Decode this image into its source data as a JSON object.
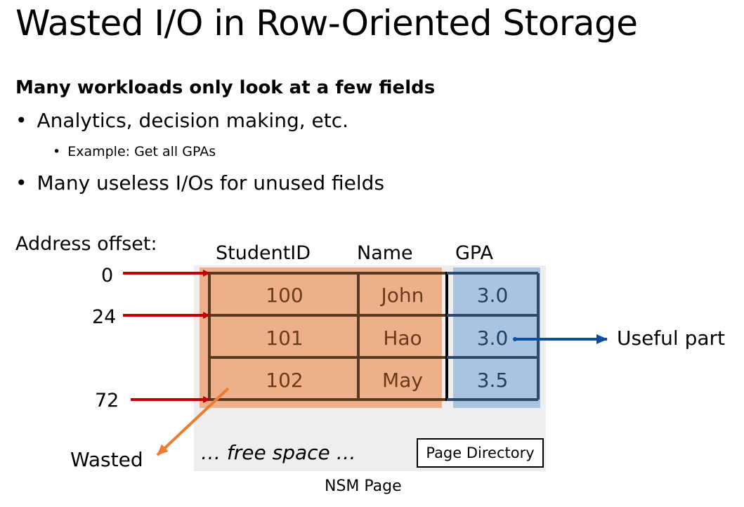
{
  "title": "Wasted I/O in Row-Oriented Storage",
  "heading": "Many workloads only look at a few fields",
  "bullets": [
    {
      "text": "Analytics, decision making, etc.",
      "level": 1
    },
    {
      "text": "Example: Get all GPAs",
      "level": 2
    },
    {
      "text": "Many useless I/Os for unused fields",
      "level": 1
    }
  ],
  "bullet_glyph": "•",
  "diagram": {
    "address_label": "Address offset:",
    "offsets": [
      "0",
      "24",
      "72"
    ],
    "columns": [
      "StudentID",
      "Name",
      "GPA"
    ],
    "rows": [
      {
        "id": "100",
        "name": "John",
        "gpa": "3.0"
      },
      {
        "id": "101",
        "name": "Hao",
        "gpa": "3.0"
      },
      {
        "id": "102",
        "name": "May",
        "gpa": "3.5"
      }
    ],
    "useful_label": "Useful part",
    "wasted_label": "Wasted",
    "free_space_label": "… free space …",
    "page_directory_label": "Page Directory",
    "page_label": "NSM Page",
    "colors": {
      "page_bg": "#eeeeee",
      "wasted_fill": "#edb08b",
      "useful_fill": "#a8c4e2",
      "row_border": "#5a3a1f",
      "gpa_border": "#2d4a6b",
      "offset_arrow": "#c00000",
      "useful_arrow": "#0b4ea2",
      "wasted_arrow": "#ed7d31"
    }
  }
}
